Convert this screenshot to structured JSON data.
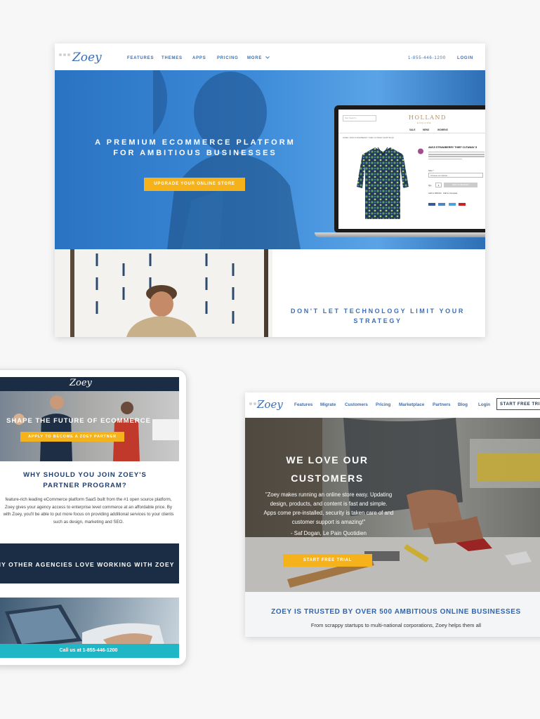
{
  "top_site": {
    "logo": "Zoey",
    "nav": [
      "FEATURES",
      "THEMES",
      "APPS",
      "PRICING",
      "MORE"
    ],
    "phone": "1-855-446-1200",
    "login": "LOGIN",
    "hero_title": "A PREMIUM ECOMMERCE PLATFORM FOR AMBITIOUS BUSINESSES",
    "cta": "UPGRADE YOUR ONLINE STORE",
    "laptop_store": {
      "brand": "HOLLAND",
      "brand_sub": "ESQUIRE",
      "menu": [
        "SALE",
        "MENS",
        "WOMENS"
      ],
      "search_placeholder": "Site Search...",
      "breadcrumb": "HOME / AW15 STRAWBERRY THIEF CUTAWAY SHIRT BLUE",
      "product_title": "AW15 STRAWBERRY THIEF CUTAWAY S",
      "size_label": "Size *",
      "size_value": "Choose an Option...",
      "qty_label": "Qty",
      "qty_value": "1",
      "add_button": "ADD TO BASKET",
      "wishlist": "Add to Wishlist",
      "compare": "Add to Compare"
    },
    "tagline": "DON'T LET TECHNOLOGY LIMIT YOUR STRATEGY"
  },
  "tablet_site": {
    "logo": "Zoey",
    "hero_title": "SHAPE THE FUTURE OF ECOMMERCE",
    "cta": "APPLY TO BECOME A ZOEY PARTNER",
    "why_title": "WHY SHOULD YOU JOIN ZOEY'S PARTNER PROGRAM?",
    "body_lines": [
      "feature-rich leading eCommerce platform SaaS built from the #1 open source platform,",
      "Zoey gives your agency access to enterprise level commerce at an affordable price. By",
      "with Zoey, you'll be able to put more focus on providing additional services to your clients",
      "such as design, marketing and SEO."
    ],
    "band_text": "S WHY OTHER AGENCIES LOVE WORKING WITH ZOEY",
    "call": "Call us at 1-855-446-1200"
  },
  "right_site": {
    "logo": "Zoey",
    "nav": [
      "Features",
      "Migrate",
      "Customers",
      "Pricing",
      "Marketplace",
      "Partners",
      "Blog",
      "Login"
    ],
    "trial_button": "START FREE TRIA",
    "hero_title": "WE LOVE OUR CUSTOMERS",
    "quote_lines": [
      "\"Zoey makes running an online store easy. Updating",
      "design, products, and content is fast and simple.",
      "Apps come pre-installed, security is taken care of and",
      "customer support is amazing!\""
    ],
    "author": "- Saf Dogan, Le Pain Quotidien",
    "cta": "START FREE TRIAL",
    "trusted": "ZOEY IS TRUSTED BY OVER 500 AMBITIOUS ONLINE BUSINESSES",
    "trusted_sub": "From scrappy startups to multi-national corporations, Zoey helps them all"
  },
  "colors": {
    "brand_blue": "#3a6fb6",
    "hero_blue": "#3c8ad8",
    "cta_yellow": "#f5b21a",
    "navy": "#1b2d44",
    "teal": "#1fb7c6"
  }
}
